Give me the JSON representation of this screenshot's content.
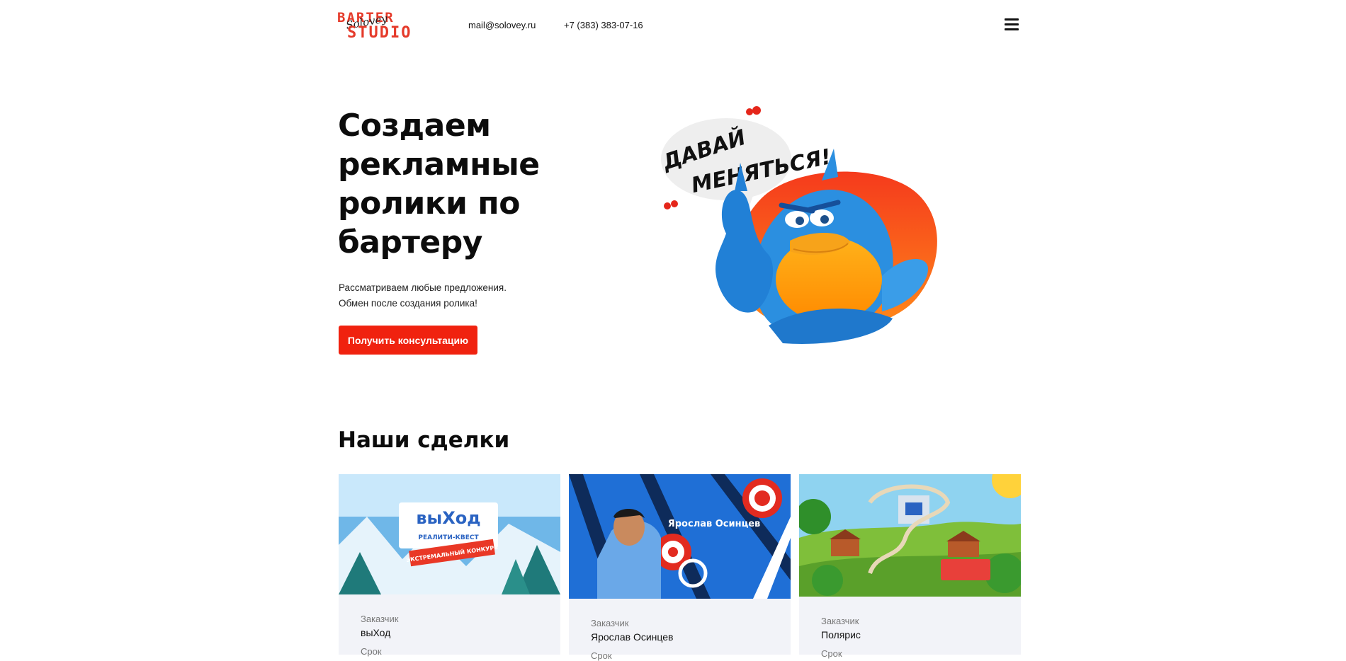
{
  "brand": {
    "logo_top": "BARTER",
    "logo_bottom": "STUDIO",
    "logo_script": "Solovey"
  },
  "header": {
    "email": "mail@solovey.ru",
    "phone": "+7 (383) 383-07-16",
    "menu_icon": "hamburger-menu-icon"
  },
  "hero": {
    "title": "Создаем рекламные ролики по бартеру",
    "subtitle_line1": "Рассматриваем любые предложения.",
    "subtitle_line2": "Обмен после создания ролика!",
    "cta_label": "Получить консультацию",
    "art_caption_1": "ДАВАЙ",
    "art_caption_2": "МЕНЯТЬСЯ!"
  },
  "deals": {
    "title": "Наши сделки",
    "customer_label": "Заказчик",
    "term_label": "Срок",
    "items": [
      {
        "customer": "выХод",
        "thumb_logo": "выХод",
        "thumb_sub": "РЕАЛИТИ-КВЕСТ",
        "thumb_banner": "ЭКСТРЕМАЛЬНЫЙ КОНКУРС"
      },
      {
        "customer": "Ярослав Осинцев",
        "thumb_text": "Ярослав Осинцев"
      },
      {
        "customer": "Полярис"
      }
    ]
  },
  "colors": {
    "accent": "#f0220f",
    "logo_red": "#e53a2a",
    "card_bg": "#f2f3f8",
    "bird_blue": "#2b8fe0"
  }
}
